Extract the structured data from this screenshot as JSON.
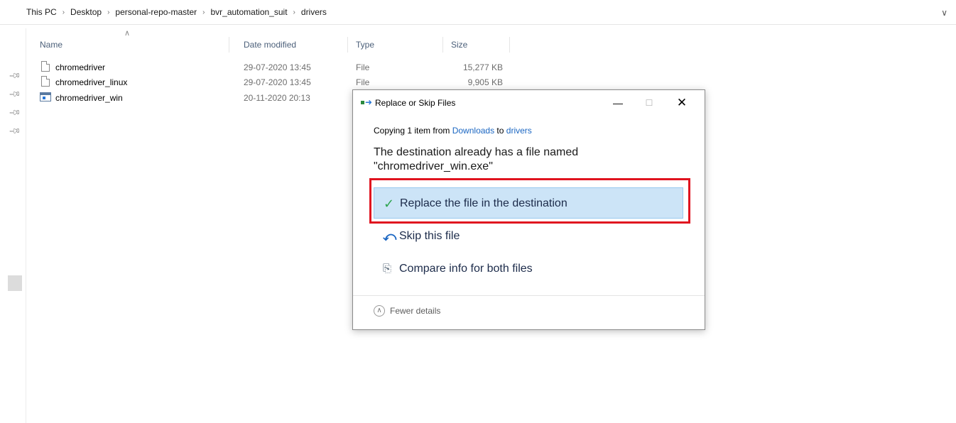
{
  "breadcrumb": {
    "items": [
      "This PC",
      "Desktop",
      "personal-repo-master",
      "bvr_automation_suit",
      "drivers"
    ],
    "separator": ">"
  },
  "address_dropdown_icon": "chevron-down-icon",
  "columns": {
    "name": "Name",
    "date": "Date modified",
    "type": "Type",
    "size": "Size"
  },
  "files": [
    {
      "name": "chromedriver",
      "date": "29-07-2020 13:45",
      "type": "File",
      "size": "15,277 KB",
      "icon": "file-icon"
    },
    {
      "name": "chromedriver_linux",
      "date": "29-07-2020 13:45",
      "type": "File",
      "size": "9,905 KB",
      "icon": "file-icon"
    },
    {
      "name": "chromedriver_win",
      "date": "20-11-2020 20:13",
      "type": "",
      "size": "",
      "icon": "exe-icon"
    }
  ],
  "dialog": {
    "title": "Replace or Skip Files",
    "copying_prefix": "Copying 1 item from ",
    "copying_source": "Downloads",
    "copying_mid": " to ",
    "copying_dest": "drivers",
    "message_line1": "The destination already has a file named",
    "message_line2": "\"chromedriver_win.exe\"",
    "options": {
      "replace": "Replace the file in the destination",
      "skip": "Skip this file",
      "compare": "Compare info for both files"
    },
    "fewer_details": "Fewer details",
    "highlight_color": "#e0131f"
  }
}
